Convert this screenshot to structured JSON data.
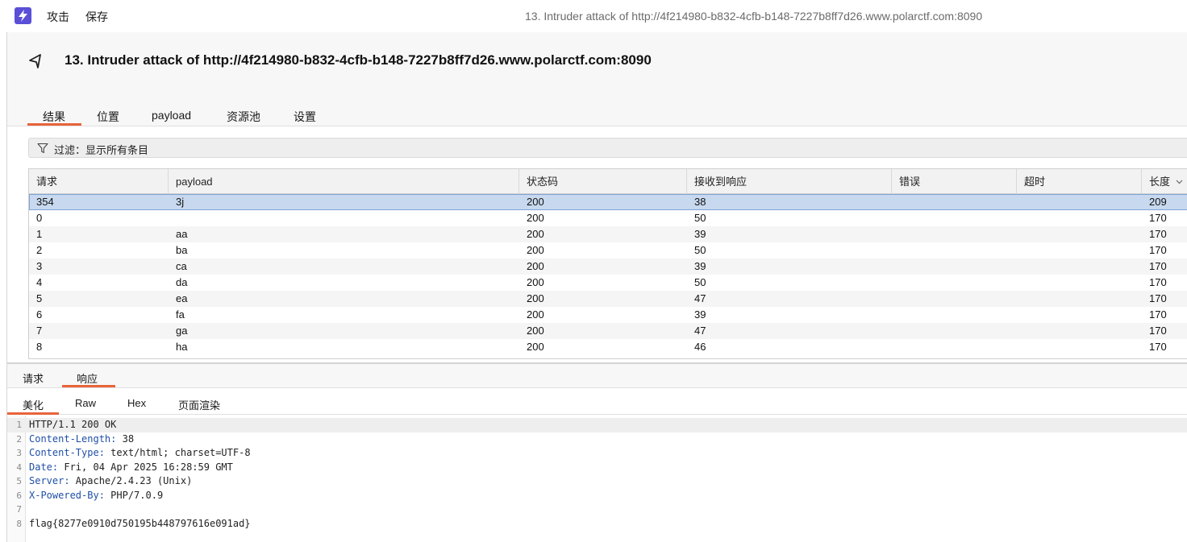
{
  "menu": {
    "attack": "攻击",
    "save": "保存"
  },
  "window_title": "13. Intruder attack of http://4f214980-b832-4cfb-b148-7227b8ff7d26.www.polarctf.com:8090",
  "attack_title": "13. Intruder attack of http://4f214980-b832-4cfb-b148-7227b8ff7d26.www.polarctf.com:8090",
  "tabs": [
    "结果",
    "位置",
    "payload",
    "资源池",
    "设置"
  ],
  "filter": {
    "label": "过滤：显示所有条目"
  },
  "table": {
    "columns": [
      "请求",
      "payload",
      "状态码",
      "接收到响应",
      "错误",
      "超时",
      "长度"
    ],
    "rows": [
      [
        "354",
        "3j",
        "200",
        "38",
        "",
        "",
        "209"
      ],
      [
        "0",
        "",
        "200",
        "50",
        "",
        "",
        "170"
      ],
      [
        "1",
        "aa",
        "200",
        "39",
        "",
        "",
        "170"
      ],
      [
        "2",
        "ba",
        "200",
        "50",
        "",
        "",
        "170"
      ],
      [
        "3",
        "ca",
        "200",
        "39",
        "",
        "",
        "170"
      ],
      [
        "4",
        "da",
        "200",
        "50",
        "",
        "",
        "170"
      ],
      [
        "5",
        "ea",
        "200",
        "47",
        "",
        "",
        "170"
      ],
      [
        "6",
        "fa",
        "200",
        "39",
        "",
        "",
        "170"
      ],
      [
        "7",
        "ga",
        "200",
        "47",
        "",
        "",
        "170"
      ],
      [
        "8",
        "ha",
        "200",
        "46",
        "",
        "",
        "170"
      ]
    ]
  },
  "subtabs": [
    "请求",
    "响应"
  ],
  "viewtabs": [
    "美化",
    "Raw",
    "Hex",
    "页面渲染"
  ],
  "response": {
    "lines": [
      {
        "n": "1",
        "key": "",
        "value": "HTTP/1.1 200 OK"
      },
      {
        "n": "2",
        "key": "Content-Length:",
        "value": " 38"
      },
      {
        "n": "3",
        "key": "Content-Type:",
        "value": " text/html; charset=UTF-8"
      },
      {
        "n": "4",
        "key": "Date:",
        "value": " Fri, 04 Apr 2025 16:28:59 GMT"
      },
      {
        "n": "5",
        "key": "Server:",
        "value": " Apache/2.4.23 (Unix)"
      },
      {
        "n": "6",
        "key": "X-Powered-By:",
        "value": " PHP/7.0.9"
      },
      {
        "n": "7",
        "key": "",
        "value": ""
      },
      {
        "n": "8",
        "key": "",
        "value": "flag{8277e0910d750195b448797616e091ad}"
      }
    ]
  },
  "colors": {
    "accent": "#e8643b",
    "selected_row": "#c8d9ef",
    "app_icon": "#5a4fd6"
  }
}
